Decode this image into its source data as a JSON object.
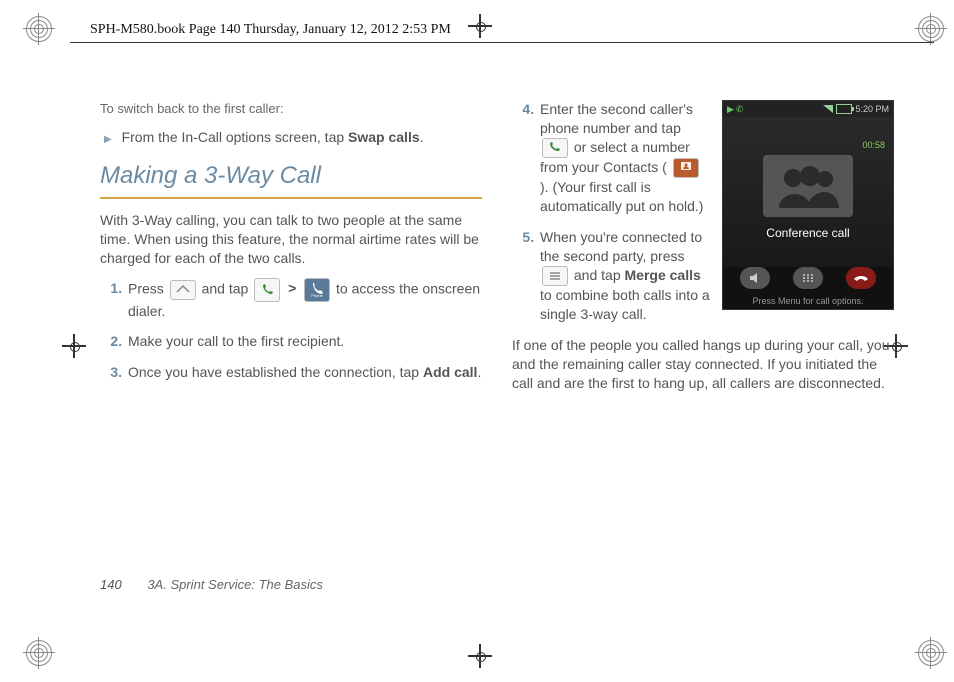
{
  "runhead": "SPH-M580.book  Page 140  Thursday, January 12, 2012  2:53 PM",
  "left": {
    "switch_lead": "To switch back to the first caller:",
    "swap_line_pre": "From the In-Call options screen, tap ",
    "swap_label": "Swap calls",
    "swap_line_post": ".",
    "heading": "Making a 3-Way Call",
    "intro": "With 3-Way calling, you can talk to two people at the same time. When using this feature, the normal airtime rates will be charged for each of the two calls.",
    "step1_pre": "Press ",
    "step1_mid": " and tap ",
    "step1_caret": ">",
    "step1_post": " to access the onscreen dialer.",
    "phone_icon_label": "Phone",
    "step2": "Make your call to the first recipient.",
    "step3_pre": "Once you have established the connection, tap ",
    "add_call": "Add call",
    "step3_post": "."
  },
  "right": {
    "s4_a": "Enter the second caller's phone number and tap ",
    "s4_b": " or select a number from your Contacts ( ",
    "contacts_icon_label": "Contacts",
    "s4_c": " ). (Your first call is automatically put on hold.)",
    "s5_a": "When you're connected to the second party, press ",
    "s5_b": " and tap ",
    "merge": "Merge calls",
    "s5_c": " to combine both calls into a single 3-way call.",
    "closing": "If one of the people you called hangs up during your call, you and the remaining caller stay connected. If you initiated the call and are the first to hang up, all callers are disconnected."
  },
  "phone_mock": {
    "time": "5:20 PM",
    "title": "Conference call",
    "elapsed": "00:58",
    "hint": "Press Menu for call options.",
    "dialpad_label": "Dialpad"
  },
  "footer": {
    "page": "140",
    "section": "3A. Sprint Service: The Basics"
  }
}
